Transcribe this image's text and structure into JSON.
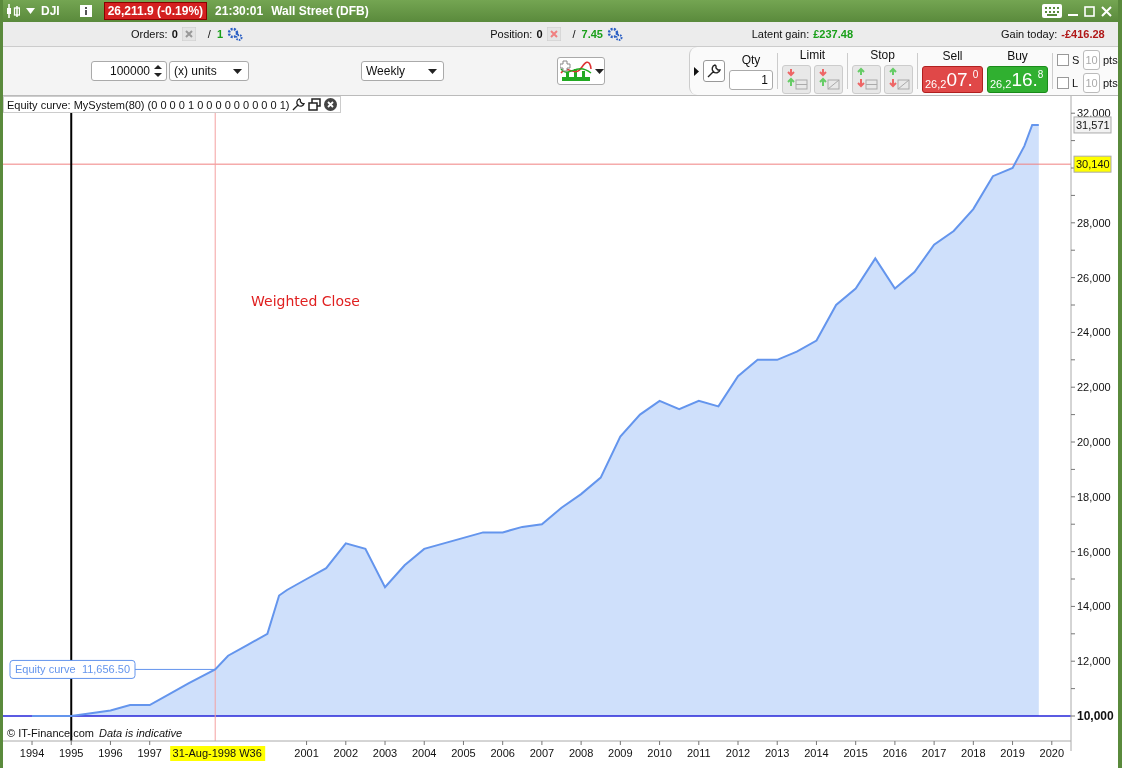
{
  "title_bar": {
    "symbol": "DJI",
    "quote": "26,211.9 (-0.19%)",
    "time": "21:30:01",
    "market": "Wall Street (DFB)"
  },
  "info_bar": [
    {
      "kind": "counter",
      "label": "Orders:",
      "count": "0",
      "separator": "/",
      "pending": "1"
    },
    {
      "kind": "counter",
      "label": "Position:",
      "count": "0",
      "separator": "/",
      "pending": "7.45"
    },
    {
      "kind": "gain",
      "label": "Latent gain:",
      "value": "£237.48"
    },
    {
      "kind": "loss",
      "label": "Gain today:",
      "value": "-£416.28"
    }
  ],
  "toolbar": {
    "quantity": "100000",
    "unit": "(x) units",
    "period": "Weekly"
  },
  "deal_ticket": {
    "qty_label": "Qty",
    "qty": "1",
    "limit_label": "Limit",
    "stop_label": "Stop",
    "sell": {
      "label": "Sell",
      "prefix": "26,2",
      "big": "07.",
      "small": "0"
    },
    "buy": {
      "label": "Buy",
      "prefix": "26,2",
      "big": "16.",
      "small": "8"
    },
    "options": [
      {
        "label": "S",
        "checked": false,
        "points": "10",
        "unit": "pts"
      },
      {
        "label": "L",
        "checked": false,
        "points": "10",
        "unit": "pts"
      }
    ]
  },
  "chart": {
    "copyright": "© IT-Finance.com",
    "disclaimer": "Data is indicative",
    "overlay_text": "Weighted Close",
    "cursor_value": "11,656.50",
    "last_value": "31,571",
    "chart_data": {
      "type": "area",
      "title": "Equity curve: MySystem(80) (0 0 0 0 1 0 0 0 0 0 0 0 0 0 1)",
      "x": [
        1994,
        1995,
        1995.5,
        1996,
        1996.5,
        1997,
        1997.5,
        1998,
        1998.67,
        1999,
        1999.5,
        2000,
        2000.3,
        2000.5,
        2001,
        2001.5,
        2002,
        2002.5,
        2003,
        2003.5,
        2004,
        2004.5,
        2005,
        2005.5,
        2006,
        2006.5,
        2007,
        2007.5,
        2008,
        2008.5,
        2009,
        2009.5,
        2010,
        2010.5,
        2011,
        2011.5,
        2012,
        2012.5,
        2013,
        2013.5,
        2014,
        2014.5,
        2015,
        2015.5,
        2016,
        2016.5,
        2017,
        2017.5,
        2018,
        2018.5,
        2019,
        2019.3,
        2019.5,
        2019.67
      ],
      "series": [
        {
          "name": "Equity curve",
          "color": "#6495ed",
          "values": [
            10000,
            10000,
            10100,
            10200,
            10400,
            10400,
            10800,
            11200,
            11700,
            12200,
            12600,
            13000,
            14400,
            14600,
            15000,
            15400,
            16300,
            16100,
            14700,
            15500,
            16100,
            16300,
            16500,
            16700,
            16700,
            16900,
            17000,
            17600,
            18100,
            18700,
            20200,
            21000,
            21500,
            21200,
            21500,
            21300,
            22400,
            23000,
            23000,
            23300,
            23700,
            25000,
            25600,
            26700,
            25600,
            26200,
            27200,
            27700,
            28500,
            29700,
            30000,
            30800,
            31571,
            31571
          ]
        }
      ],
      "xlim": [
        1993.26,
        2020.49
      ],
      "ylim": [
        9088,
        32628
      ],
      "xticks": [
        1994,
        1995,
        1996,
        1997,
        2001,
        2002,
        2003,
        2004,
        2005,
        2006,
        2007,
        2008,
        2009,
        2010,
        2011,
        2012,
        2013,
        2014,
        2015,
        2016,
        2017,
        2018,
        2019,
        2020
      ],
      "yticks": [
        {
          "value": 10000,
          "label": "10,000"
        },
        {
          "value": 12000,
          "label": "12,000"
        },
        {
          "value": 14000,
          "label": "14,000"
        },
        {
          "value": 16000,
          "label": "16,000"
        },
        {
          "value": 18000,
          "label": "18,000"
        },
        {
          "value": 20000,
          "label": "20,000"
        },
        {
          "value": 22000,
          "label": "22,000"
        },
        {
          "value": 24000,
          "label": "24,000"
        },
        {
          "value": 26000,
          "label": "26,000"
        },
        {
          "value": 28000,
          "label": "28,000"
        },
        {
          "value": 32000,
          "label": "32,000"
        }
      ],
      "ref_lines": [
        {
          "axis": "y",
          "value": 10000,
          "color": "#2424d8"
        },
        {
          "axis": "x",
          "value": 1995,
          "color": "#000000"
        },
        {
          "axis": "y",
          "value": 30140,
          "label": "30,140",
          "color": "#f08080"
        },
        {
          "axis": "x",
          "value": 1998.67,
          "label": "31-Aug-1998 W36",
          "color": "#f4a0a0"
        }
      ]
    }
  }
}
